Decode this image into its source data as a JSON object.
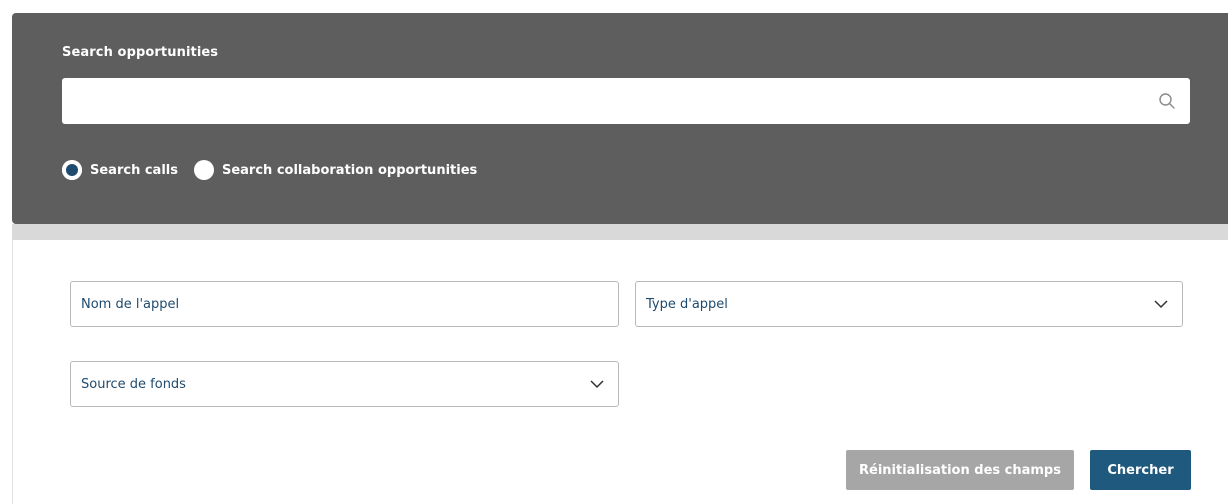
{
  "search": {
    "title": "Search opportunities",
    "value": "",
    "placeholder": "",
    "icon": "search-icon"
  },
  "search_type": {
    "options": [
      {
        "label": "Search calls",
        "checked": true
      },
      {
        "label": "Search collaboration opportunities",
        "checked": false
      }
    ]
  },
  "filters": {
    "call_name_label": "Nom de l'appel",
    "call_type_label": "Type d'appel",
    "funding_source_label": "Source de fonds"
  },
  "actions": {
    "reset_label": "Réinitialisation des champs",
    "search_label": "Chercher"
  },
  "colors": {
    "panel": "#5e5e5e",
    "accent": "#1f5a7e",
    "reset_button": "#a6a6a6",
    "label_text": "#1f4b6e"
  }
}
